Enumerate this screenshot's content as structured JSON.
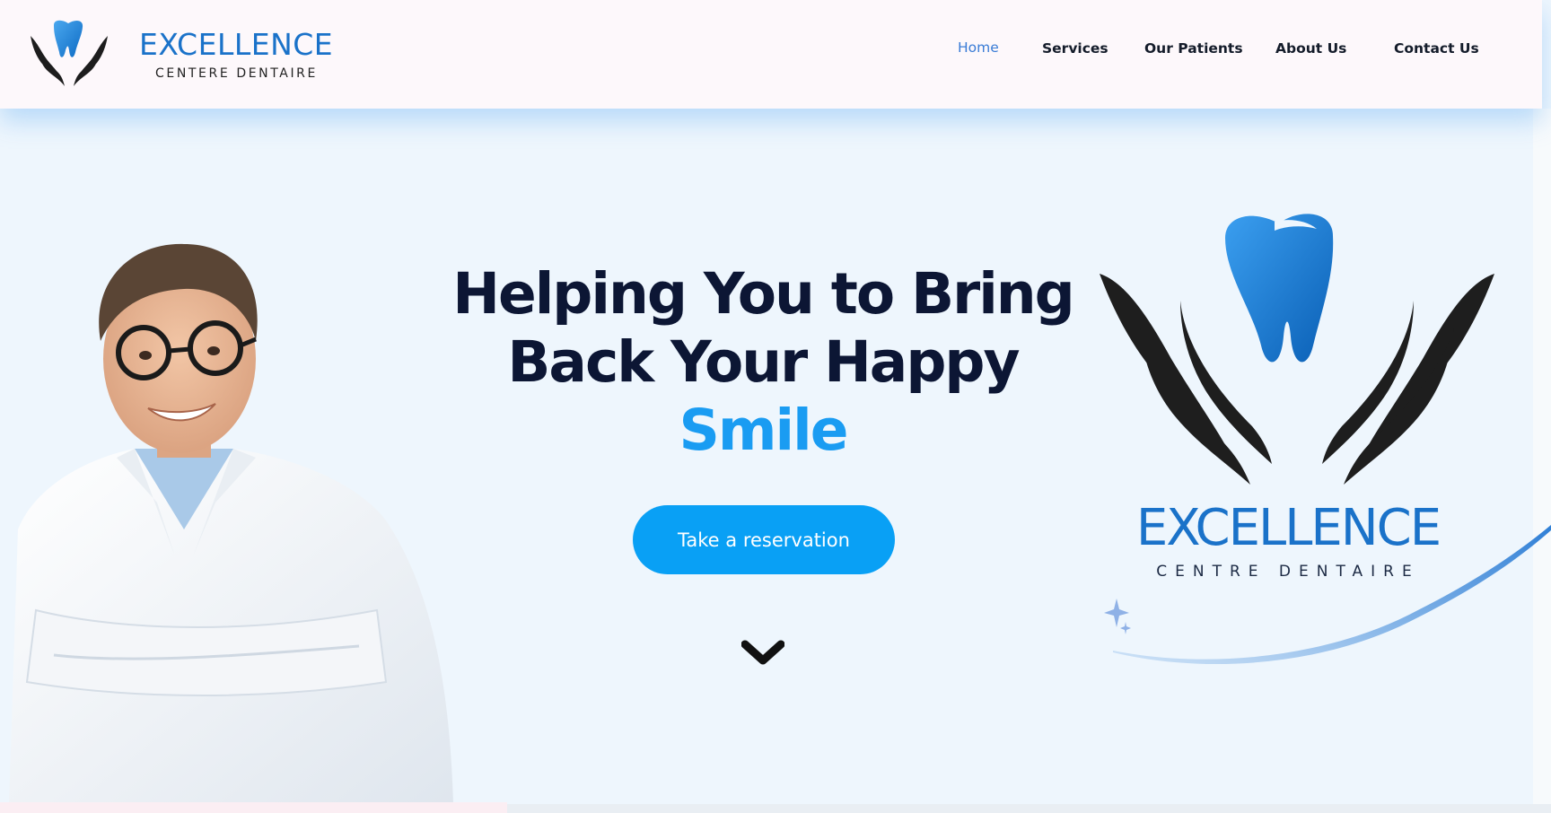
{
  "header": {
    "brand_name": "EXCELLENCE",
    "brand_tagline": "CENTERE DENTAIRE",
    "nav": [
      {
        "label": "Home",
        "active": true
      },
      {
        "label": "Services",
        "active": false
      },
      {
        "label": "Our Patients",
        "active": false
      },
      {
        "label": "About Us",
        "active": false
      },
      {
        "label": "Contact Us",
        "active": false
      }
    ]
  },
  "hero": {
    "headline_line1": "Helping You to Bring",
    "headline_line2": "Back Your Happy",
    "headline_accent": "Smile",
    "cta_label": "Take a reservation",
    "scroll_icon": "chevron-down-icon"
  },
  "logo_block": {
    "name": "EXCELLENCE",
    "tagline": "CENTRE DENTAIRE"
  },
  "colors": {
    "brand_blue": "#1a72c9",
    "accent_blue": "#1a9cf2",
    "cta_blue": "#09a0f5",
    "headline_dark": "#0c1634",
    "active_nav": "#3a7cd6",
    "hero_bg": "#eef6fd",
    "header_bg": "#fdf8fb"
  }
}
